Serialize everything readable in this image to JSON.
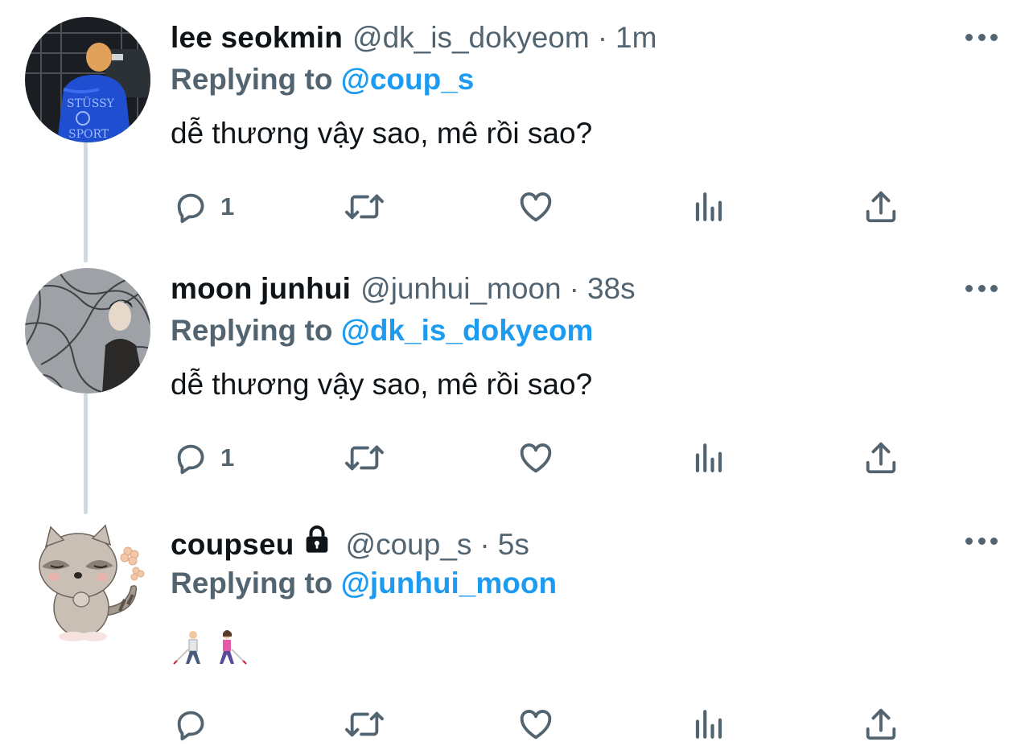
{
  "tweets": [
    {
      "name": "lee seokmin",
      "handle": "@dk_is_dokyeom",
      "separator": "·",
      "time": "1m",
      "replying_label": "Replying to",
      "replying_to": "@coup_s",
      "text": "dễ thương vậy sao, mê rồi sao?",
      "reply_count": "1",
      "locked": false
    },
    {
      "name": "moon junhui",
      "handle": "@junhui_moon",
      "separator": "·",
      "time": "38s",
      "replying_label": "Replying to",
      "replying_to": "@dk_is_dokyeom",
      "text": "dễ thương vậy sao, mê rồi sao?",
      "reply_count": "1",
      "locked": false
    },
    {
      "name": "coupseu",
      "handle": "@coup_s",
      "separator": "·",
      "time": "5s",
      "replying_label": "Replying to",
      "replying_to": "@junhui_moon",
      "text": "",
      "emoji": [
        "person-with-white-cane-emoji",
        "woman-with-white-cane-emoji"
      ],
      "reply_count": "",
      "locked": true
    }
  ],
  "icons": [
    "reply-icon",
    "retweet-icon",
    "like-icon",
    "analytics-icon",
    "share-icon",
    "more-icon",
    "lock-icon"
  ],
  "colors": {
    "text": "#0f1419",
    "secondary": "#536471",
    "mention": "#1d9bf0",
    "thread_line": "#cfd9de",
    "background": "#ffffff"
  }
}
